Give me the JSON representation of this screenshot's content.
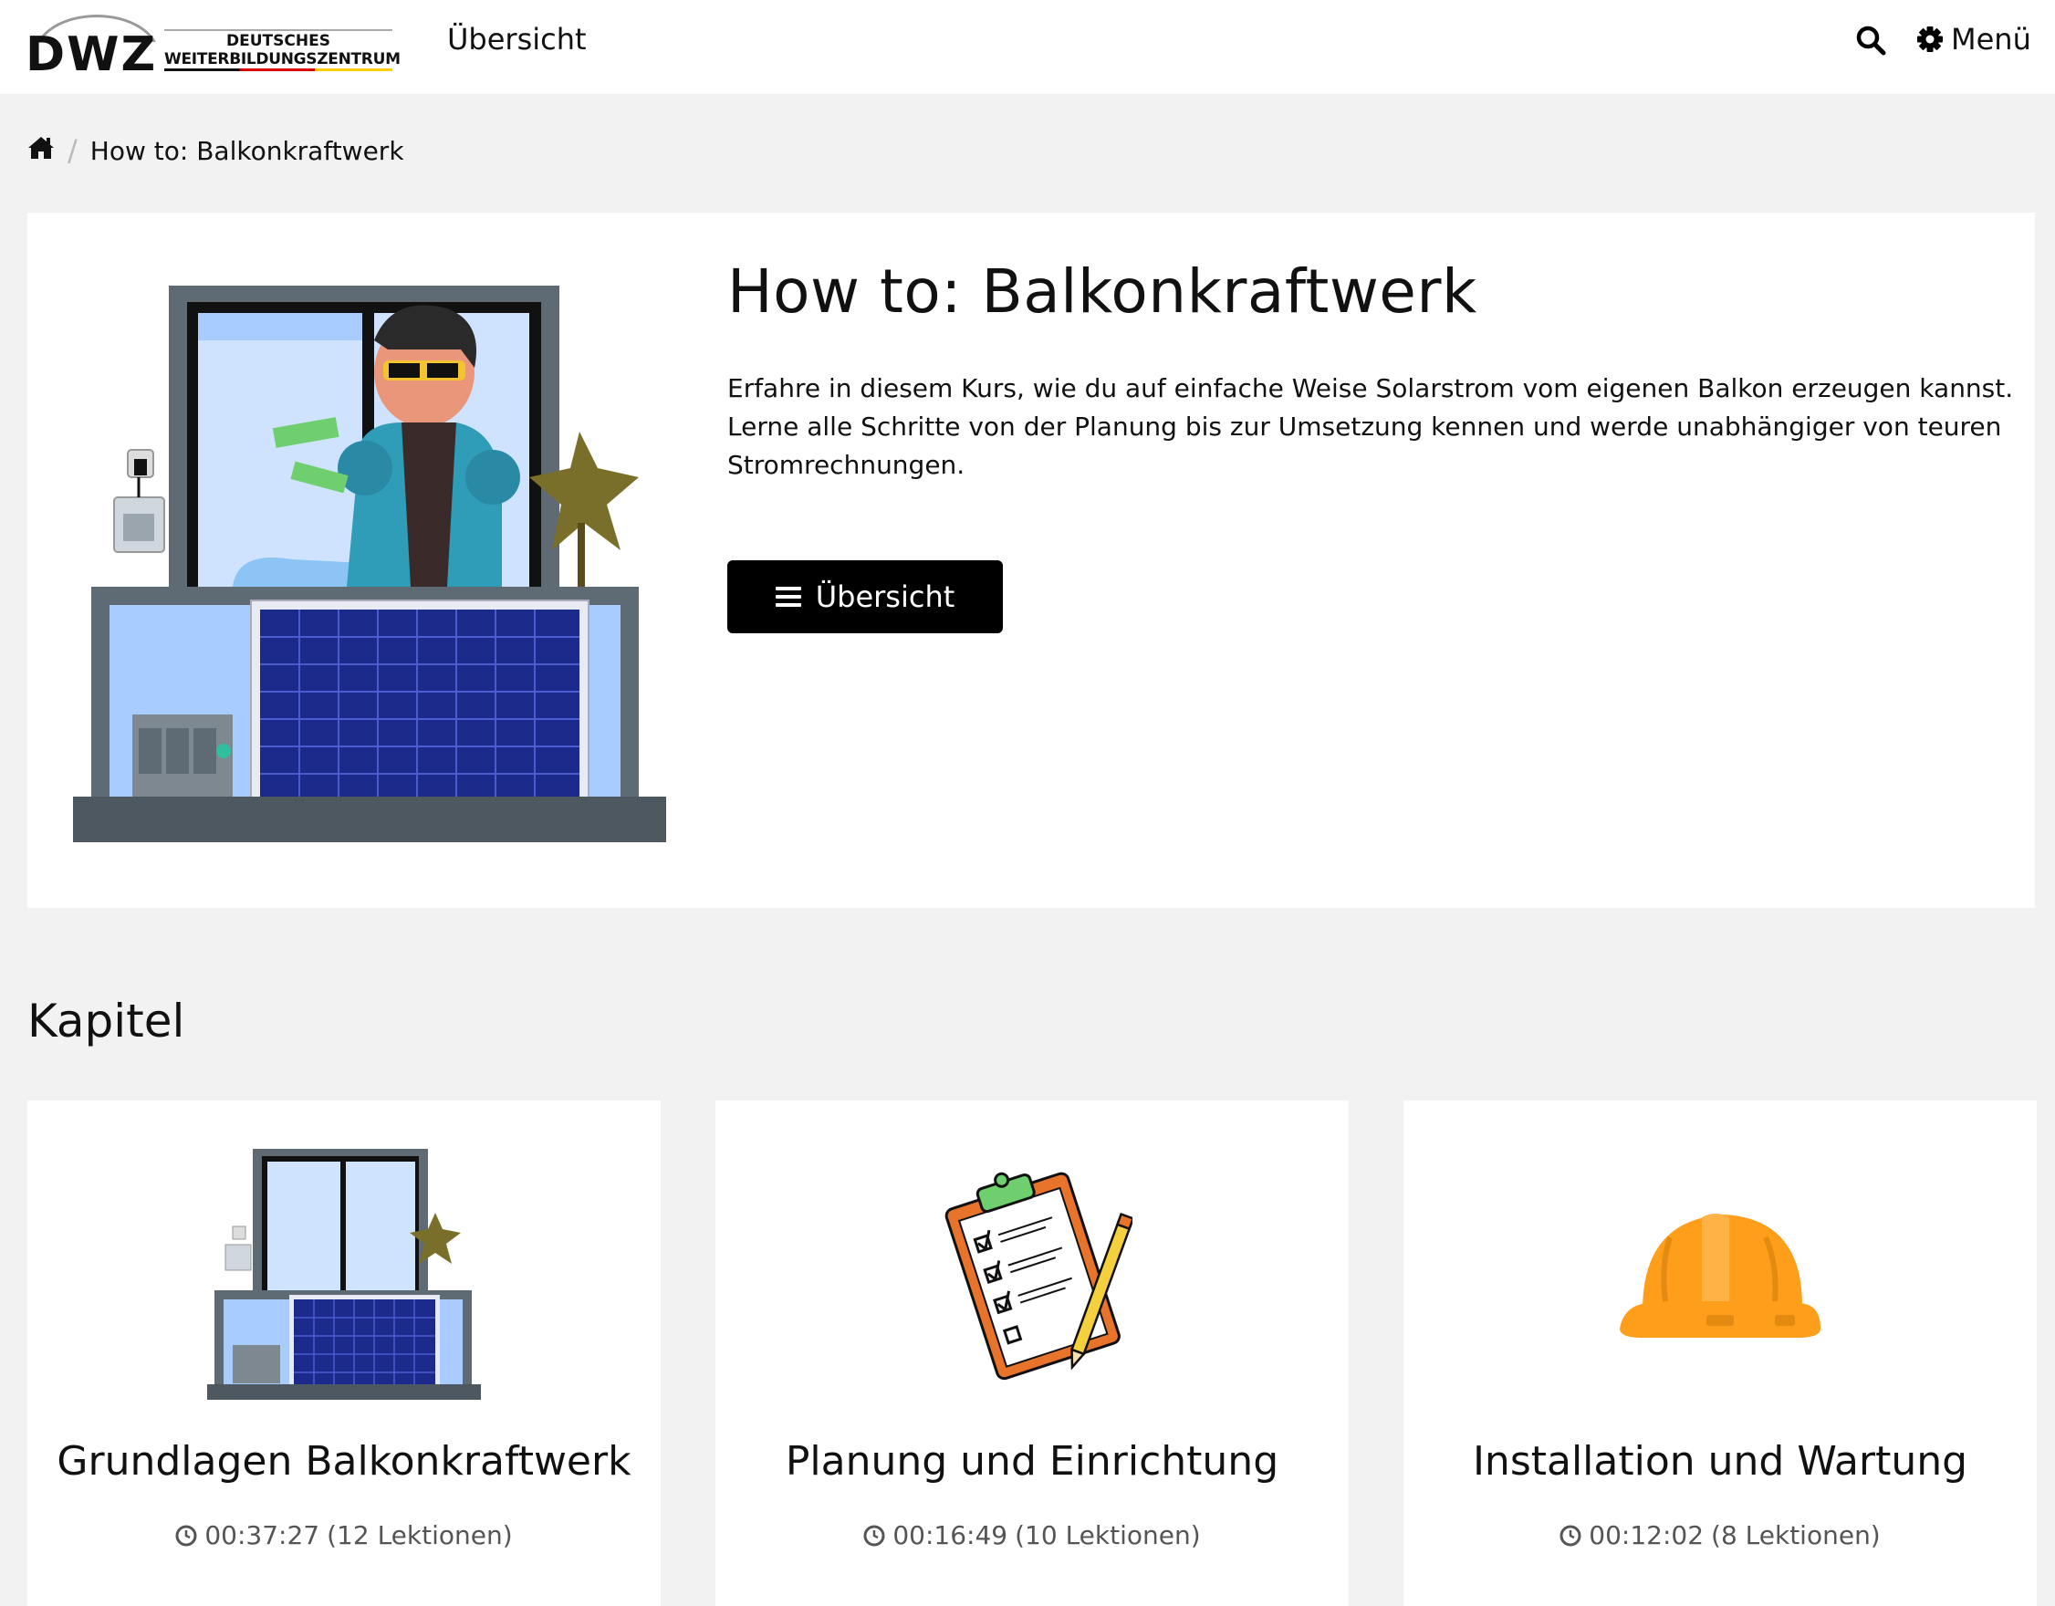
{
  "header": {
    "logo_short": "DWZ",
    "logo_line1": "DEUTSCHES",
    "logo_line2": "WEITERBILDUNGSZENTRUM",
    "nav_overview": "Übersicht",
    "menu_label": "Menü",
    "icons": [
      "search-icon",
      "gear-icon"
    ]
  },
  "breadcrumb": {
    "home_icon": "home-icon",
    "current": "How to: Balkonkraftwerk"
  },
  "hero": {
    "title": "How to: Balkonkraftwerk",
    "description": "Erfahre in diesem Kurs, wie du auf einfache Weise Solarstrom vom eigenen Balkon erzeugen kannst. Lerne alle Schritte von der Planung bis zur Umsetzung kennen und werde unabhängiger von teuren Stromrechnungen.",
    "button_label": "Übersicht",
    "button_icon": "bars-icon"
  },
  "chapters": {
    "title": "Kapitel",
    "items": [
      {
        "title": "Grundlagen Balkonkraftwerk",
        "duration": "00:37:27",
        "lessons": "(12 Lektionen)",
        "icon": "balcony-solar-illustration"
      },
      {
        "title": "Planung und Einrichtung",
        "duration": "00:16:49",
        "lessons": "(10 Lektionen)",
        "icon": "clipboard-checklist-illustration"
      },
      {
        "title": "Installation und Wartung",
        "duration": "00:12:02",
        "lessons": "(8 Lektionen)",
        "icon": "hard-hat-illustration"
      }
    ]
  },
  "colors": {
    "background": "#f2f2f2",
    "card": "#ffffff",
    "button": "#000000",
    "solar_panel": "#1c2a8c",
    "hard_hat": "#ff9e1b",
    "clipboard": "#e8742c"
  }
}
